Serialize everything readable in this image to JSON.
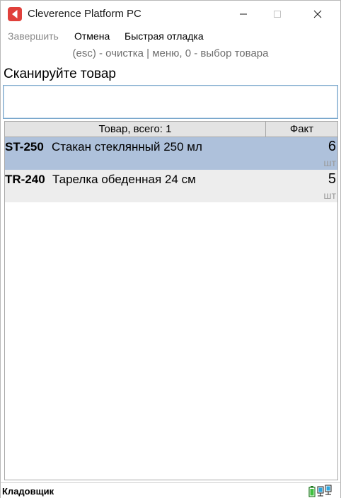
{
  "window": {
    "title": "Cleverence Platform PC",
    "icons": {
      "app": "cleverence-app-icon",
      "minimize": "minimize-icon",
      "maximize": "maximize-icon",
      "close": "close-icon"
    }
  },
  "menu": {
    "items": [
      {
        "label": "Завершить",
        "disabled": true
      },
      {
        "label": "Отмена",
        "disabled": false
      },
      {
        "label": "Быстрая отладка",
        "disabled": false
      }
    ]
  },
  "hint": "(esc) - очистка | меню, 0 - выбор товара",
  "prompt": "Сканируйте товар",
  "scan_input": {
    "value": "",
    "placeholder": ""
  },
  "table": {
    "headers": {
      "product": "Товар, всего: 1",
      "fact": "Факт"
    },
    "rows": [
      {
        "code": "ST-250",
        "name": "Стакан стеклянный 250 мл",
        "qty": "6",
        "unit": "шт",
        "selected": true
      },
      {
        "code": "TR-240",
        "name": "Тарелка обеденная 24 см",
        "qty": "5",
        "unit": "шт",
        "selected": false
      }
    ]
  },
  "status": {
    "user": "Кладовщик",
    "icons": [
      "battery-icon",
      "network-icon"
    ]
  },
  "colors": {
    "selected_row": "#aec1db",
    "normal_row": "#ededed",
    "app_icon": "#e0403b",
    "header_bg": "#e3e3e3"
  }
}
